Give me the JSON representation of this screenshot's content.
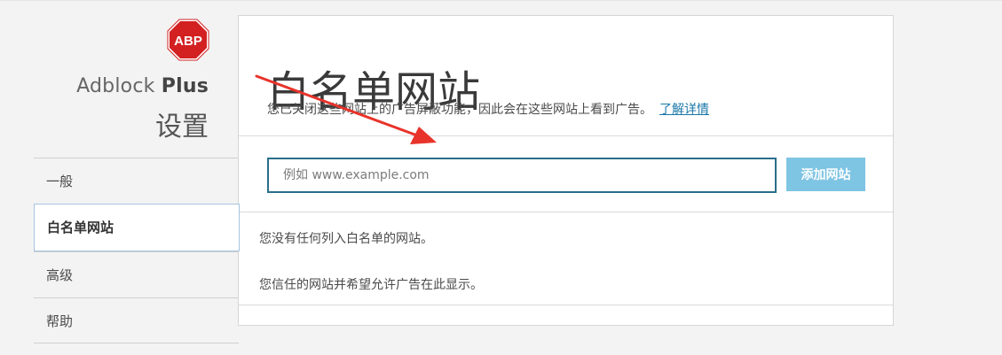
{
  "colors": {
    "accent": "#2a6e8a",
    "button": "#7ec4e3",
    "logo_red": "#d32020",
    "arrow_red": "#e8332a"
  },
  "logo": {
    "icon": "abp-stop-sign-icon",
    "text": "ABP"
  },
  "brand": {
    "name_light": "Adblock",
    "name_bold": "Plus"
  },
  "sidebar": {
    "title": "设置",
    "items": [
      {
        "label": "一般"
      },
      {
        "label": "白名单网站"
      },
      {
        "label": "高级"
      },
      {
        "label": "帮助"
      }
    ],
    "active_index": 1
  },
  "main": {
    "title": "白名单网站",
    "description": "您已关闭这些网站上的广告屏蔽功能，因此会在这些网站上看到广告。",
    "learn_more": "了解详情",
    "input": {
      "value": "",
      "placeholder": "例如 www.example.com"
    },
    "add_button": "添加网站",
    "empty_message": "您没有任何列入白名单的网站。",
    "hint_message": "您信任的网站并希望允许广告在此显示。"
  }
}
